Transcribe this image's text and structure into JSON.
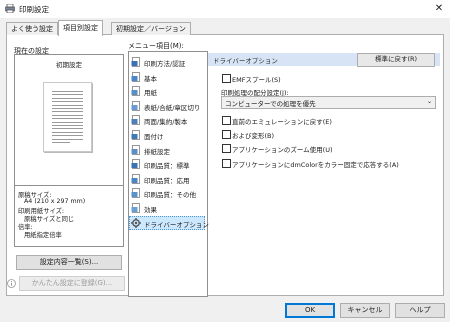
{
  "window": {
    "title": "印刷設定",
    "close_glyph": "✕"
  },
  "tabs": [
    "よく使う設定",
    "項目別設定",
    "初期設定／バージョン"
  ],
  "current_settings": {
    "label": "現在の設定",
    "preview_caption": "初期設定",
    "info_lines": [
      "原稿サイズ:",
      "A4 (210 x 297 mm)",
      "印刷用紙サイズ:",
      "原稿サイズと同じ",
      "倍率:",
      "用紙指定倍率"
    ]
  },
  "buttons": {
    "details": "設定内容一覧(S)...",
    "register": "かんたん設定に登録(G)...",
    "ok": "OK",
    "cancel": "キャンセル",
    "help": "ヘルプ",
    "defaults": "標準に戻す(R)"
  },
  "menu": {
    "label": "メニュー項目(M):",
    "items": [
      {
        "label": "印刷方法/認証",
        "icon": "print-method-icon"
      },
      {
        "label": "基本",
        "icon": "basic-icon"
      },
      {
        "label": "用紙",
        "icon": "paper-icon"
      },
      {
        "label": "表紙/合紙/章区切り",
        "icon": "cover-icon"
      },
      {
        "label": "両面/集約/製本",
        "icon": "duplex-icon"
      },
      {
        "label": "面付け",
        "icon": "imposition-icon"
      },
      {
        "label": "排紙設定",
        "icon": "output-icon"
      },
      {
        "label": "印刷品質：標準",
        "icon": "quality-icon"
      },
      {
        "label": "印刷品質：応用",
        "icon": "quality-advanced-icon"
      },
      {
        "label": "印刷品質：その他",
        "icon": "quality-other-icon"
      },
      {
        "label": "効果",
        "icon": "effects-icon"
      },
      {
        "label": "ドライバーオプション",
        "icon": "driver-options-icon"
      }
    ],
    "selected_index": 11
  },
  "driver_options": {
    "header": "ドライバーオプション",
    "emf_spool": {
      "label": "EMFスプール(S)",
      "checked": false
    },
    "distribution": {
      "label": "印刷処理の配分設定(J):",
      "value": "コンピューターでの処理を優先"
    },
    "options": [
      {
        "label": "直前のエミュレーションに戻す(E)",
        "checked": false
      },
      {
        "label": "および変形(B)",
        "checked": false
      },
      {
        "label": "アプリケーションのズーム使用(U)",
        "checked": false
      },
      {
        "label": "アプリケーションにdmColorをカラー固定で応答する(A)",
        "checked": false
      }
    ]
  }
}
